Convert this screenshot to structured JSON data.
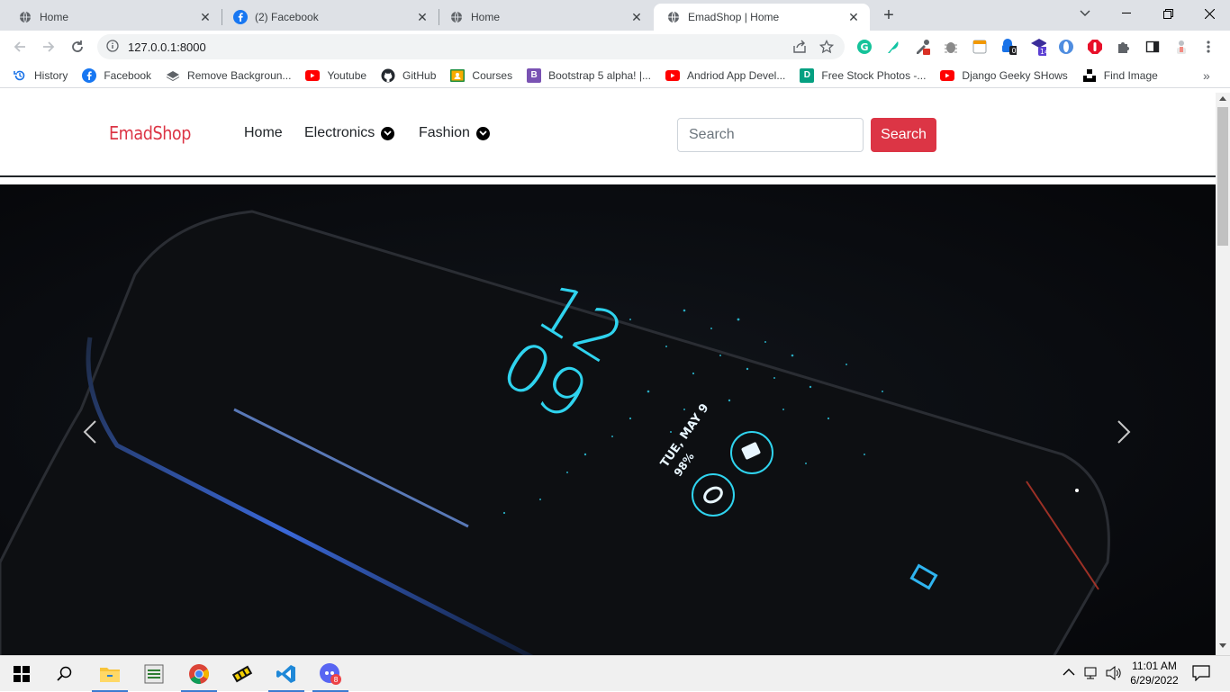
{
  "browser": {
    "tabs": [
      {
        "title": "Home",
        "icon": "globe-icon"
      },
      {
        "title": "(2) Facebook",
        "icon": "facebook-icon"
      },
      {
        "title": "Home",
        "icon": "globe-icon"
      },
      {
        "title": "EmadShop | Home",
        "icon": "globe-icon",
        "active": true
      }
    ],
    "address": "127.0.0.1:8000",
    "extensions": [
      {
        "icon": "grammarly-icon",
        "color": "#15c39a"
      },
      {
        "icon": "extension-feather-icon",
        "color": "#11c4a3"
      },
      {
        "icon": "eyedropper-icon",
        "badge": ""
      },
      {
        "icon": "bug-icon"
      },
      {
        "icon": "notes-icon"
      },
      {
        "icon": "extension-lock-icon",
        "badge": "0"
      },
      {
        "icon": "graduation-cap-icon",
        "badge": "14"
      },
      {
        "icon": "opera-icon"
      },
      {
        "icon": "adblock-icon"
      },
      {
        "icon": "puzzle-icon"
      },
      {
        "icon": "side-panel-icon"
      },
      {
        "icon": "profile-icon"
      }
    ],
    "bookmarks": [
      {
        "label": "History",
        "icon": "history-icon",
        "color": "#1a73e8"
      },
      {
        "label": "Facebook",
        "icon": "facebook-icon",
        "color": "#1877f2"
      },
      {
        "label": "Remove Backgroun...",
        "icon": "layers-icon",
        "color": "#5f6368"
      },
      {
        "label": "Youtube",
        "icon": "youtube-icon",
        "color": "#ff0000"
      },
      {
        "label": "GitHub",
        "icon": "github-icon",
        "color": "#24292f"
      },
      {
        "label": "Courses",
        "icon": "classroom-icon",
        "color": "#1e8e3e"
      },
      {
        "label": "Bootstrap 5 alpha! |...",
        "icon": "bootstrap-icon",
        "color": "#7952b3"
      },
      {
        "label": "Andriod App Devel...",
        "icon": "youtube-icon",
        "color": "#ff0000"
      },
      {
        "label": "Free Stock Photos -...",
        "icon": "stock-photo-icon",
        "color": "#05a081"
      },
      {
        "label": "Django Geeky SHows",
        "icon": "youtube-icon",
        "color": "#ff0000"
      },
      {
        "label": "Find Image",
        "icon": "unsplash-icon",
        "color": "#000000"
      }
    ]
  },
  "site": {
    "brand": "EmadShop",
    "nav": [
      {
        "label": "Home",
        "dropdown": false
      },
      {
        "label": "Electronics",
        "dropdown": true
      },
      {
        "label": "Fashion",
        "dropdown": true
      }
    ],
    "search": {
      "placeholder": "Search",
      "button": "Search"
    },
    "carousel": {
      "slide": {
        "time_hour": "12",
        "time_min": "09",
        "date": "TUE, MAY 9",
        "battery": "98%"
      }
    },
    "colors": {
      "brand": "#dc3545",
      "accent": "#dc3545",
      "glow": "#2fd3ee"
    }
  },
  "taskbar": {
    "apps": [
      {
        "icon": "file-explorer-icon",
        "active": true
      },
      {
        "icon": "lottery-app-icon",
        "active": false
      },
      {
        "icon": "chrome-icon",
        "active": true
      },
      {
        "icon": "memory-chip-app-icon",
        "active": false
      },
      {
        "icon": "vscode-icon",
        "active": true
      },
      {
        "icon": "discord-like-app-icon",
        "active": true,
        "badge": "8"
      }
    ],
    "time": "11:01 AM",
    "date": "6/29/2022"
  }
}
